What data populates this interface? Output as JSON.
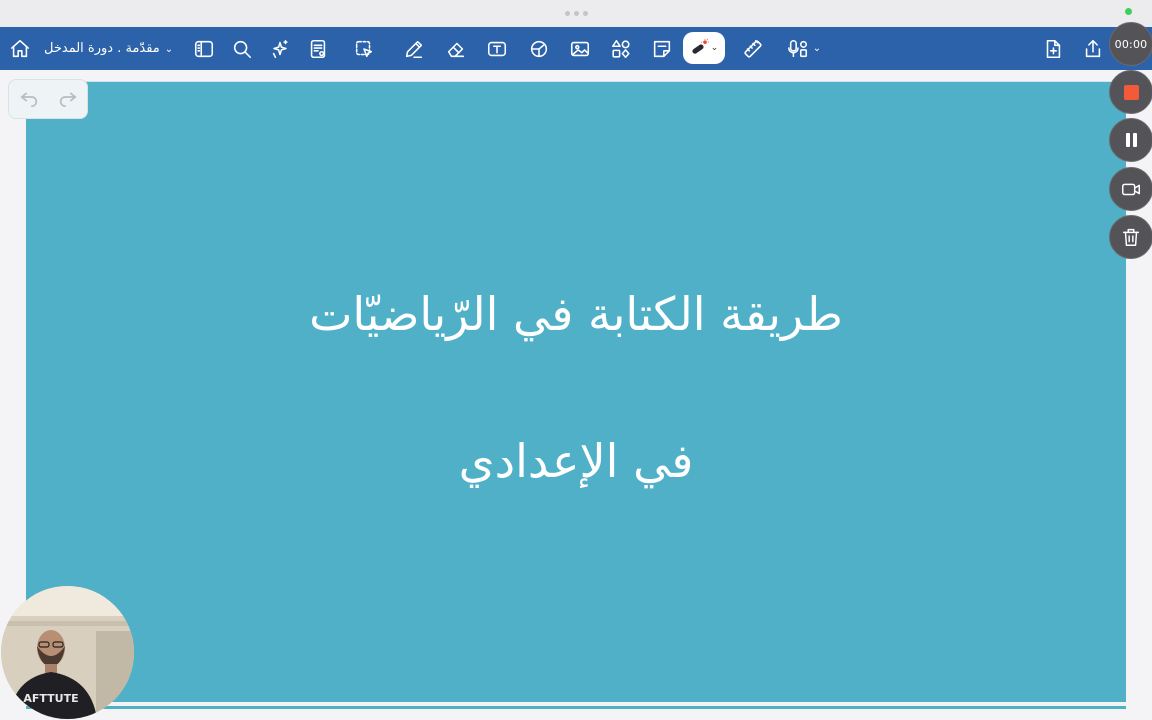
{
  "toolbar": {
    "document_title": "مقدّمة . دورة المدخل",
    "icons": [
      "home-icon",
      "sidebar-icon",
      "search-icon",
      "sparkle-icon",
      "page-view-icon",
      "lasso-icon",
      "pen-icon",
      "eraser-icon",
      "text-box-icon",
      "shapes-icon",
      "image-icon",
      "elements-icon",
      "sticky-note-icon",
      "laser-pointer-icon",
      "ruler-icon",
      "audio-record-icon",
      "add-page-icon",
      "share-icon"
    ]
  },
  "recording": {
    "timer": "00:00"
  },
  "slide": {
    "line1": "طريقة الكتابة في الرّياضيّات",
    "line2": "في الإعدادي"
  },
  "webcam": {
    "shirt_text": "AFTTUTE"
  },
  "colors": {
    "toolbar": "#2b62a9",
    "slide_background": "#4fb0c8",
    "record_stop": "#f25a3a",
    "status_dot": "#3ecf5a"
  }
}
